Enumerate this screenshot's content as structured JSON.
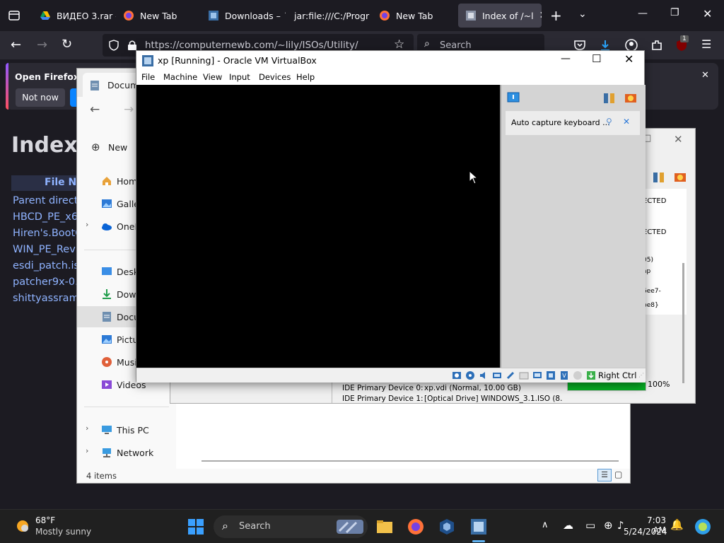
{
  "firefox": {
    "tabs": [
      {
        "label": "ВИДЕО 3.rar -",
        "icon": "google-drive-icon"
      },
      {
        "label": "New Tab",
        "icon": "firefox-icon"
      },
      {
        "label": "Downloads – ˙",
        "icon": "virtualbox-icon"
      },
      {
        "label": "jar:file:///C:/Progr",
        "icon": ""
      },
      {
        "label": "New Tab",
        "icon": "firefox-icon"
      },
      {
        "label": "Index of /~l",
        "icon": "virtualbox-icon",
        "active": true
      }
    ],
    "url": "https://computernewb.com/~lily/ISOs/Utility/",
    "search_placeholder": "Search",
    "badge_count": "1",
    "notification": {
      "text": "Open Firefox ev",
      "button": "Not now"
    }
  },
  "page": {
    "title": "Index",
    "column_header": "File N",
    "links": [
      "Parent direct",
      "HBCD_PE_x6",
      "Hiren's.BootC",
      "WIN_PE_Rev",
      "esdi_patch.is",
      "patcher9x-0.",
      "shittyassram"
    ]
  },
  "explorer": {
    "tab_title": "Docum",
    "new_label": "New",
    "nav_items": [
      "Home",
      "Galler",
      "OneD",
      "Deskt",
      "Down",
      "Docu",
      "Pictu",
      "Musi",
      "Videos",
      "This PC",
      "Network"
    ],
    "status": "4 items"
  },
  "details": {
    "lines_right": [
      "ECTED",
      "ECTED",
      "05)",
      "ap",
      "6ee7-",
      "be8}"
    ],
    "ide0_label": "IDE Primary Device 0:",
    "ide0_value": "xp.vdi (Normal, 10.00 GB)",
    "ide1_label": "IDE Primary Device 1:",
    "ide1_value": "[Optical Drive] WINDOWS_3.1.ISO (8.",
    "progress_percent": 100,
    "progress_label": "100%"
  },
  "vbox": {
    "title": "xp [Running] - Oracle VM VirtualBox",
    "menu": [
      "File",
      "Machine",
      "View",
      "Input",
      "Devices",
      "Help"
    ],
    "notice": "Auto capture keyboard ...",
    "host_key": "Right Ctrl"
  },
  "taskbar": {
    "weather_temp": "68°F",
    "weather_desc": "Mostly sunny",
    "search_label": "Search",
    "time": "7:03 AM",
    "date": "5/24/2024"
  },
  "colors": {
    "accent_blue": "#0060df",
    "link": "#8fb3ff",
    "progress_green": "#06b025"
  }
}
